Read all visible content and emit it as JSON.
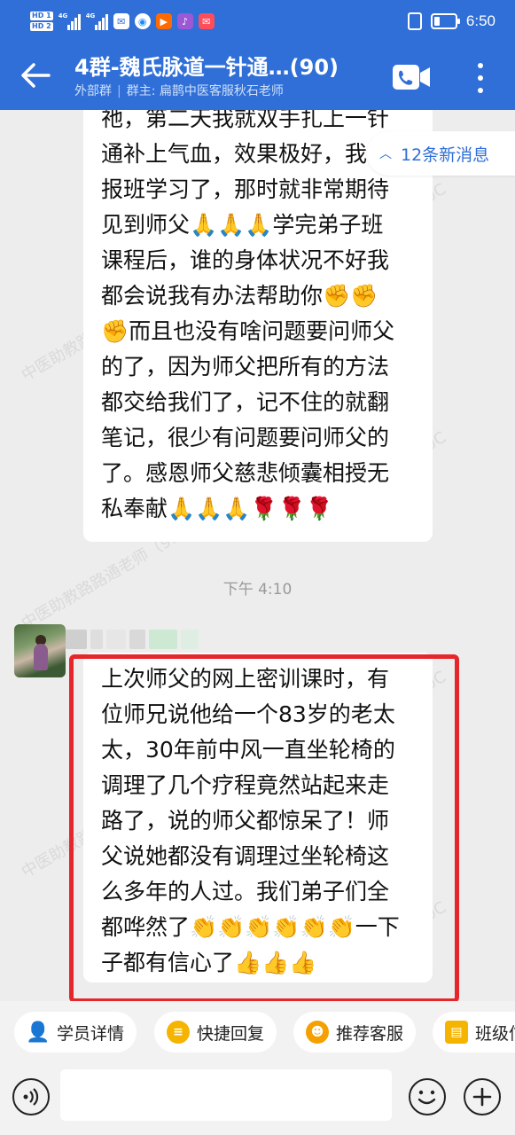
{
  "status_bar": {
    "hd1": "HD 1",
    "hd2": "HD 2",
    "net1": "4G",
    "net2": "4G",
    "time": "6:50"
  },
  "header": {
    "title": "4群-魏氏脉道一针通…(90)",
    "tag": "外部群",
    "owner": "群主: 扁鹊中医客服秋石老师"
  },
  "chat": {
    "new_messages": "12条新消息",
    "message1": "祂，第二天我就双手扎上一针\n通补上气血，效果极好，我\n报班学习了，那时就非常期待\n见到师父🙏🙏🙏学完弟子班\n课程后，谁的身体状况不好我\n都会说我有办法帮助你✊✊\n✊而且也没有啥问题要问师父\n的了，因为师父把所有的方法\n都交给我们了，记不住的就翻\n笔记，很少有问题要问师父的\n了。感恩师父慈悲倾囊相授无\n私奉献🙏🙏🙏🌹🌹🌹",
    "timestamp": "下午 4:10",
    "message2": "上次师父的网上密训课时，有\n位师兄说他给一个83岁的老太\n太，30年前中风一直坐轮椅的\n调理了几个疗程竟然站起来走\n路了，说的师父都惊呆了！师\n父说她都没有调理过坐轮椅这\n么多年的人过。我们弟子们全\n都哗然了👏👏👏👏👏👏一下\n子都有信心了👍👍👍",
    "watermark": "中医助教路路通老师（9: 0C"
  },
  "quick_actions": [
    {
      "label": "学员详情",
      "icon": "user-icon",
      "color": "#22b04b"
    },
    {
      "label": "快捷回复",
      "icon": "quick-reply-icon",
      "color": "#f5b400"
    },
    {
      "label": "推荐客服",
      "icon": "service-icon",
      "color": "#f5a000"
    },
    {
      "label": "班级信",
      "icon": "class-icon",
      "color": "#f5b400"
    }
  ],
  "input": {
    "placeholder": ""
  },
  "colors": {
    "brand": "#2f6fd7",
    "highlight": "#e5262a"
  }
}
